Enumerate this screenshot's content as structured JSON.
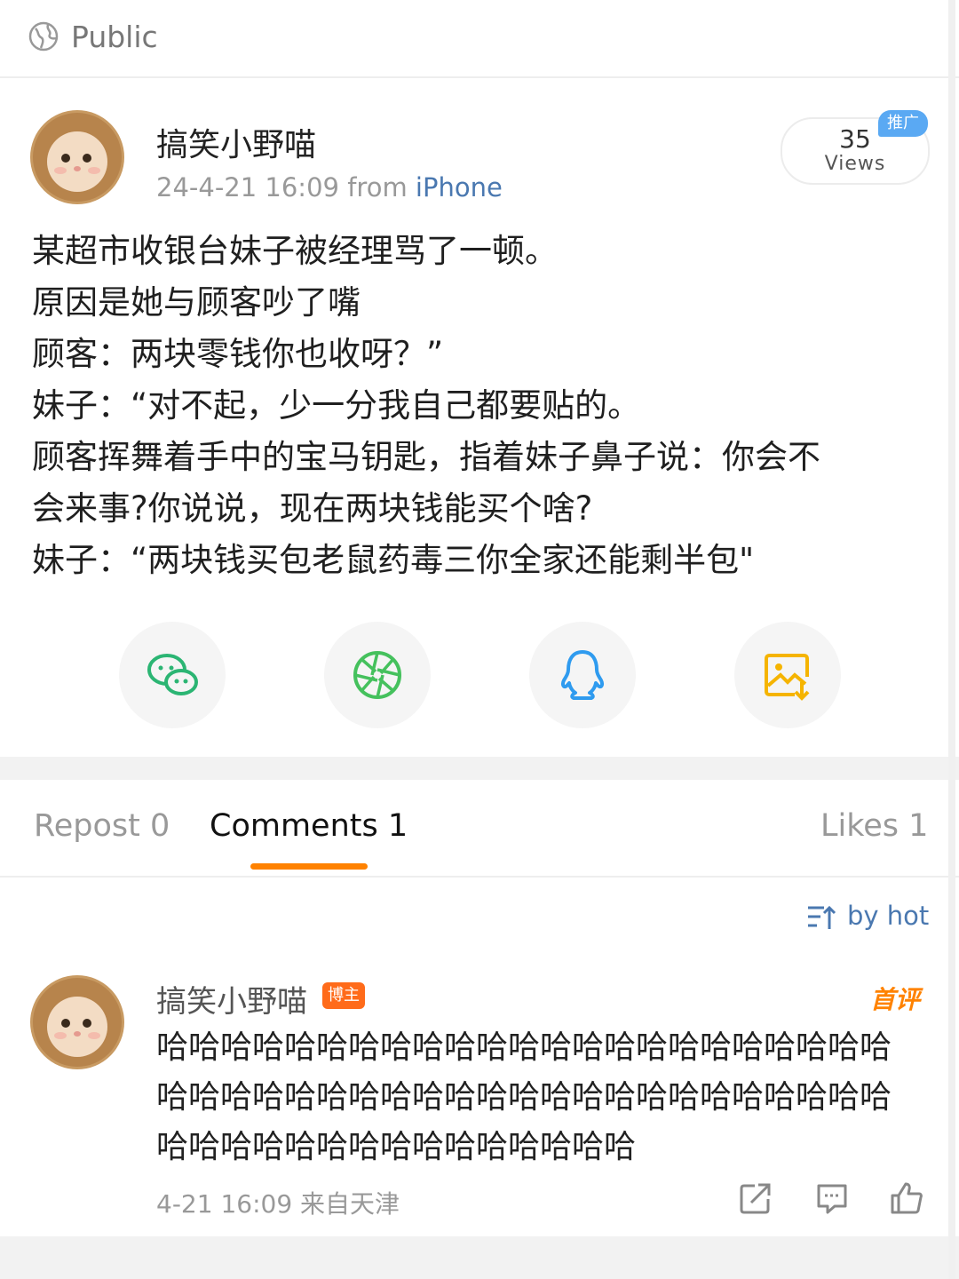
{
  "header": {
    "visibility_label": "Public",
    "visibility_icon": "globe-icon"
  },
  "post": {
    "author": "搞笑小野喵",
    "time": "24-4-21 16:09",
    "from_prefix": "from",
    "source": "iPhone",
    "views_count": "35",
    "views_label": "Views",
    "promo_badge": "推广",
    "text_lines": [
      "某超市收银台妹子被经理骂了一顿。",
      "原因是她与顾客吵了嘴",
      "顾客：两块零钱你也收呀？”",
      "妹子：“对不起，少一分我自己都要贴的。",
      "顾客挥舞着手中的宝马钥匙，指着妹子鼻子说：你会不",
      "会来事?你说说，现在两块钱能买个啥?",
      "妹子：“两块钱买包老鼠药毒三你全家还能剩半包\""
    ]
  },
  "share": [
    {
      "name": "wechat-icon",
      "color": "#2bb573"
    },
    {
      "name": "moments-icon",
      "color": "#45c15d"
    },
    {
      "name": "qq-icon",
      "color": "#2f9bef"
    },
    {
      "name": "save-image-icon",
      "color": "#f5b400"
    }
  ],
  "tabs": {
    "repost": "Repost 0",
    "comments": "Comments 1",
    "likes": "Likes 1",
    "accent": "#ff8200"
  },
  "sort": {
    "label": "by hot",
    "icon": "sort-icon"
  },
  "comment": {
    "author": "搞笑小野喵",
    "owner_badge": "博主",
    "first_badge": "首评",
    "text": "哈哈哈哈哈哈哈哈哈哈哈哈哈哈哈哈哈哈哈哈哈哈哈哈哈哈哈哈哈哈哈哈哈哈哈哈哈哈哈哈哈哈哈哈哈哈哈哈哈哈哈哈哈哈哈哈哈哈哈哈哈",
    "time": "4-21 16:09",
    "location": "来自天津"
  },
  "colors": {
    "link": "#4a78b0",
    "badge_orange": "#ff6b1a",
    "promo_blue": "#5aa9f3"
  }
}
